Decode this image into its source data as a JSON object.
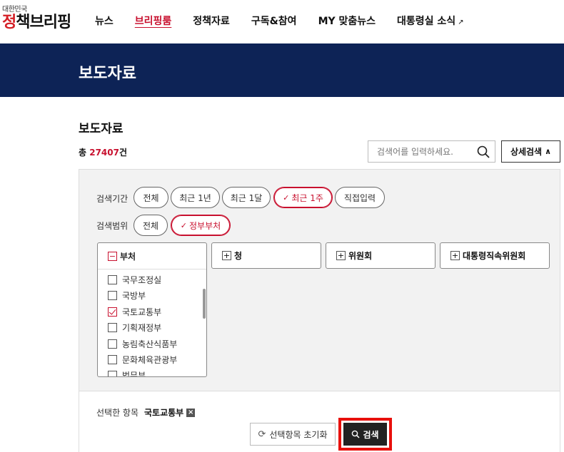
{
  "logo": {
    "small": "대한민국",
    "big_prefix": "정",
    "big_rest": "책브리핑"
  },
  "nav": [
    {
      "label": "뉴스"
    },
    {
      "label": "브리핑룸",
      "active": true
    },
    {
      "label": "정책자료"
    },
    {
      "label": "구독&참여"
    },
    {
      "label": "MY 맞춤뉴스"
    },
    {
      "label": "대통령실 소식",
      "icon": "external-arrow-icon",
      "icon_glyph": "↗"
    }
  ],
  "banner": {
    "title": "보도자료"
  },
  "section": {
    "title": "보도자료",
    "total_prefix": "총 ",
    "total_count": "27407",
    "total_suffix": "건"
  },
  "search": {
    "placeholder": "검색어를 입력하세요.",
    "value": ""
  },
  "detail_search": {
    "label": "상세검색",
    "chevron": "∧"
  },
  "filters": {
    "period": {
      "label": "검색기간",
      "options": [
        {
          "label": "전체"
        },
        {
          "label": "최근 1년"
        },
        {
          "label": "최근 1달"
        },
        {
          "label": "최근 1주",
          "selected": true
        },
        {
          "label": "직접입력"
        }
      ]
    },
    "scope": {
      "label": "검색범위",
      "options": [
        {
          "label": "전체"
        },
        {
          "label": "정부부처",
          "selected": true
        }
      ]
    },
    "categories": [
      {
        "label": "부처",
        "expanded": true,
        "glyph": "−"
      },
      {
        "label": "청",
        "glyph": "+"
      },
      {
        "label": "위원회",
        "glyph": "+"
      },
      {
        "label": "대통령직속위원회",
        "glyph": "+"
      }
    ],
    "departments": [
      {
        "label": "국무조정실",
        "checked": false
      },
      {
        "label": "국방부",
        "checked": false
      },
      {
        "label": "국토교통부",
        "checked": true
      },
      {
        "label": "기획재정부",
        "checked": false
      },
      {
        "label": "농림축산식품부",
        "checked": false
      },
      {
        "label": "문화체육관광부",
        "checked": false
      },
      {
        "label": "법무부",
        "checked": false
      }
    ],
    "check_glyph": "✓"
  },
  "selected": {
    "label": "선택한 항목",
    "item": "국토교통부",
    "remove_glyph": "×"
  },
  "actions": {
    "reset_label": "선택항목 초기화",
    "reset_glyph": "⟳",
    "search_label": "검색"
  },
  "colors": {
    "accent": "#c8102e",
    "banner": "#0d2356",
    "highlight": "#e8100c"
  }
}
